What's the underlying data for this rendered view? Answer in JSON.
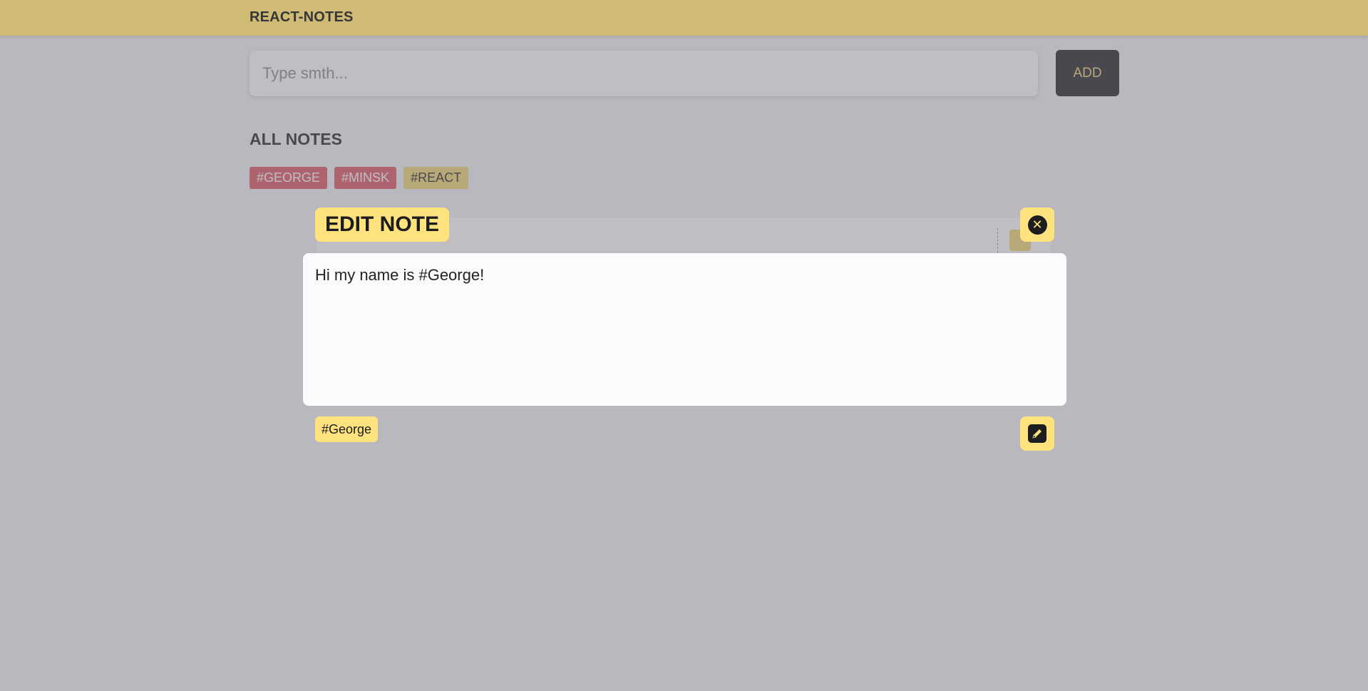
{
  "app": {
    "title": "REACT-NOTES"
  },
  "search": {
    "placeholder": "Type smth...",
    "value": ""
  },
  "add_button": {
    "label": "ADD"
  },
  "notes_section": {
    "title": "ALL NOTES"
  },
  "filter_tags": [
    {
      "label": "#GEORGE",
      "color": "#e0535e"
    },
    {
      "label": "#MINSK",
      "color": "#e0535e"
    },
    {
      "label": "#REACT",
      "color": "#f2d66f"
    }
  ],
  "modal": {
    "title": "EDIT NOTE",
    "text": "Hi my name is #George!",
    "tags": [
      "#George"
    ],
    "close_icon": "close-icon",
    "save_icon": "pencil-icon"
  },
  "colors": {
    "accent": "#f2d66f",
    "accent_light": "#fee27d",
    "dark": "#1e1e1f",
    "tag_red": "#e0535e"
  }
}
